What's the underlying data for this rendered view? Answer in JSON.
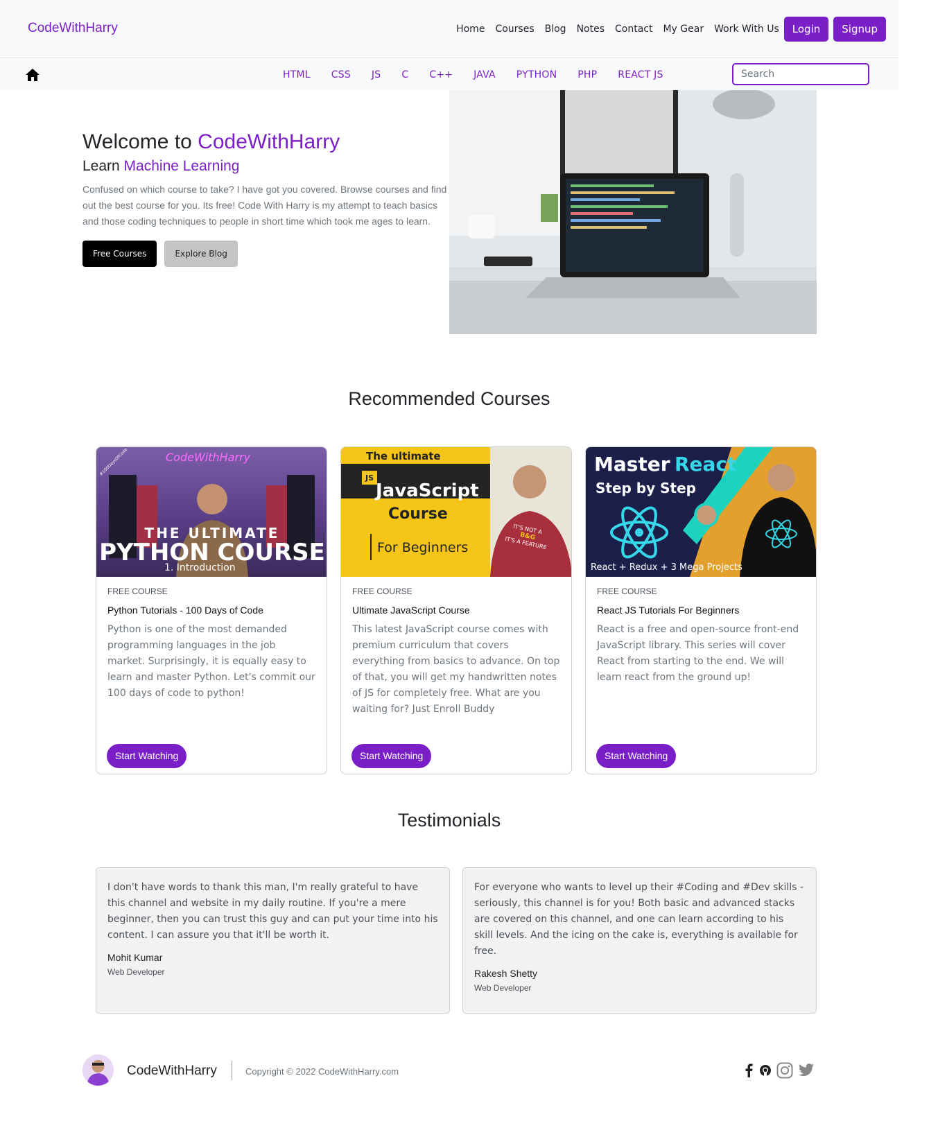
{
  "header": {
    "brand": "CodeWithHarry",
    "nav": [
      "Home",
      "Courses",
      "Blog",
      "Notes",
      "Contact",
      "My Gear",
      "Work With Us"
    ],
    "login_label": "Login",
    "signup_label": "Signup",
    "accent_color": "#7a1fc7"
  },
  "subnav": {
    "home_icon": "home-icon",
    "languages": [
      "HTML",
      "CSS",
      "JS",
      "C",
      "C++",
      "JAVA",
      "PYTHON",
      "PHP",
      "REACT JS"
    ],
    "search_placeholder": "Search"
  },
  "hero": {
    "title_prefix": "Welcome to ",
    "title_accent": "CodeWithHarry",
    "sub_prefix": "Learn ",
    "sub_accent": "Machine Learning",
    "description": "Confused on which course to take? I have got you covered. Browse courses and find out the best course for you. Its free! Code With Harry is my attempt to teach basics and those coding techniques to people in short time which took me ages to learn.",
    "btn_primary": "Free Courses",
    "btn_secondary": "Explore Blog"
  },
  "recommended": {
    "title": "Recommended Courses",
    "cards": [
      {
        "thumb_lines": [
          "CodeWithHarry",
          "THE ULTIMATE",
          "PYTHON COURSE",
          "1. Introduction",
          "#100DaysOfCode"
        ],
        "type": "Free Course",
        "title": "Python Tutorials - 100 Days of Code",
        "description": "Python is one of the most demanded programming languages in the job market. Surprisingly, it is equally easy to learn and master Python. Let's commit our 100 days of code to python!",
        "button": "Start Watching"
      },
      {
        "thumb_lines": [
          "The ultimate",
          "JS",
          "JavaScript",
          "Course",
          "For Beginners",
          "IT'S NOT A",
          "B&G",
          "IT'S A FEATURE"
        ],
        "type": "Free Course",
        "title": "Ultimate JavaScript Course",
        "description": "This latest JavaScript course comes with premium curriculum that covers everything from basics to advance. On top of that, you will get my handwritten notes of JS for completely free. What are you waiting for? Just Enroll Buddy",
        "button": "Start Watching"
      },
      {
        "thumb_lines": [
          "Master",
          "React",
          "Step by Step",
          "React + Redux + 3 Mega Projects"
        ],
        "type": "Free Course",
        "title": "React JS Tutorials For Beginners",
        "description": "React is a free and open-source front-end JavaScript library. This series will cover React from starting to the end. We will learn react from the ground up!",
        "button": "Start Watching"
      }
    ]
  },
  "testimonials": {
    "title": "Testimonials",
    "items": [
      {
        "text": "I don't have words to thank this man, I'm really grateful to have this channel and website in my daily routine. If you're a mere beginner, then you can trust this guy and can put your time into his content. I can assure you that it'll be worth it.",
        "name": "Mohit Kumar",
        "role": "Web Developer"
      },
      {
        "text": "For everyone who wants to level up their #Coding and #Dev skills - seriously, this channel is for you! Both basic and advanced stacks are covered on this channel, and one can learn according to his skill levels. And the icing on the cake is, everything is available for free.",
        "name": "Rakesh Shetty",
        "role": "Web Developer"
      }
    ]
  },
  "footer": {
    "brand": "CodeWithHarry",
    "copyright": "Copyright © 2022 CodeWithHarry.com",
    "social_icons": [
      "facebook-icon",
      "github-icon",
      "instagram-icon",
      "twitter-icon"
    ]
  }
}
